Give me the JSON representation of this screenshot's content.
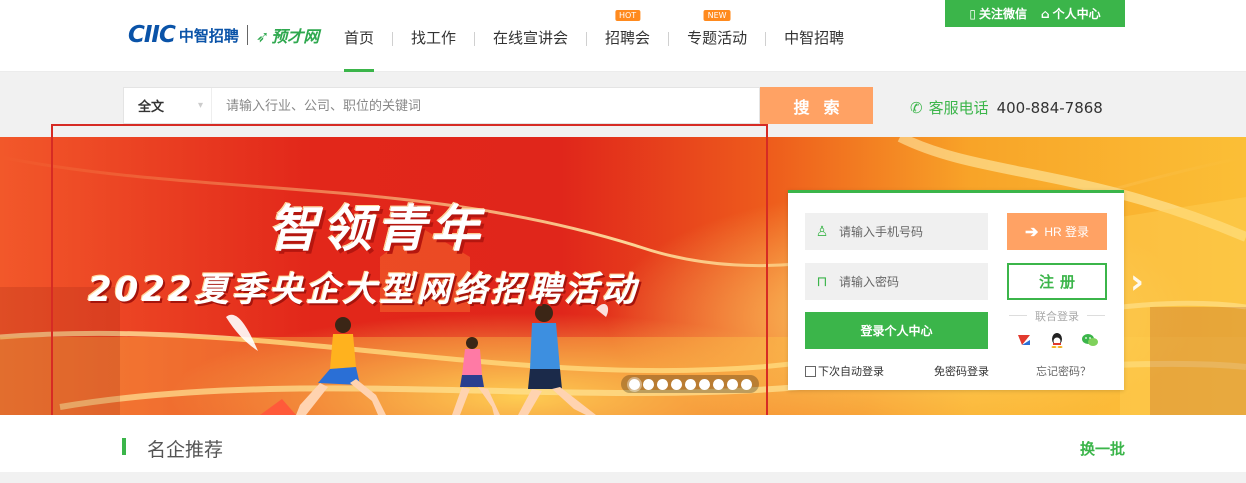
{
  "brand": {
    "logo_ciic": "CIIC",
    "logo_cn": "中智招聘",
    "logo_sub": "预才网"
  },
  "nav": {
    "items": [
      {
        "label": "首页",
        "badge": ""
      },
      {
        "label": "找工作",
        "badge": ""
      },
      {
        "label": "在线宣讲会",
        "badge": ""
      },
      {
        "label": "招聘会",
        "badge": "HOT"
      },
      {
        "label": "专题活动",
        "badge": "NEW"
      },
      {
        "label": "中智招聘",
        "badge": ""
      }
    ],
    "active_index": 0
  },
  "user_links": {
    "wechat": "关注微信",
    "personal_center": "个人中心"
  },
  "search": {
    "type_label": "全文",
    "placeholder": "请输入行业、公司、职位的关键词",
    "button_label": "搜索"
  },
  "hotline": {
    "label": "客服电话",
    "number": "400-884-7868"
  },
  "banner": {
    "title": "智领青年",
    "subtitle": "2022夏季央企大型网络招聘活动",
    "dot_count": 9,
    "active_dot": 0
  },
  "login": {
    "phone_placeholder": "请输入手机号码",
    "password_placeholder": "请输入密码",
    "login_label": "登录个人中心",
    "hr_label": "HR 登录",
    "register_label": "注册",
    "union_label": "联合登录",
    "remember_label": "下次自动登录",
    "no_password_label": "免密码登录",
    "forgot_label": "忘记密码？"
  },
  "section": {
    "title": "名企推荐",
    "refresh_label": "换一批"
  },
  "colors": {
    "accent_green": "#3bb54a",
    "accent_orange": "#ffa264",
    "brand_blue": "#0a53a8",
    "highlight_red": "#d62b24"
  }
}
